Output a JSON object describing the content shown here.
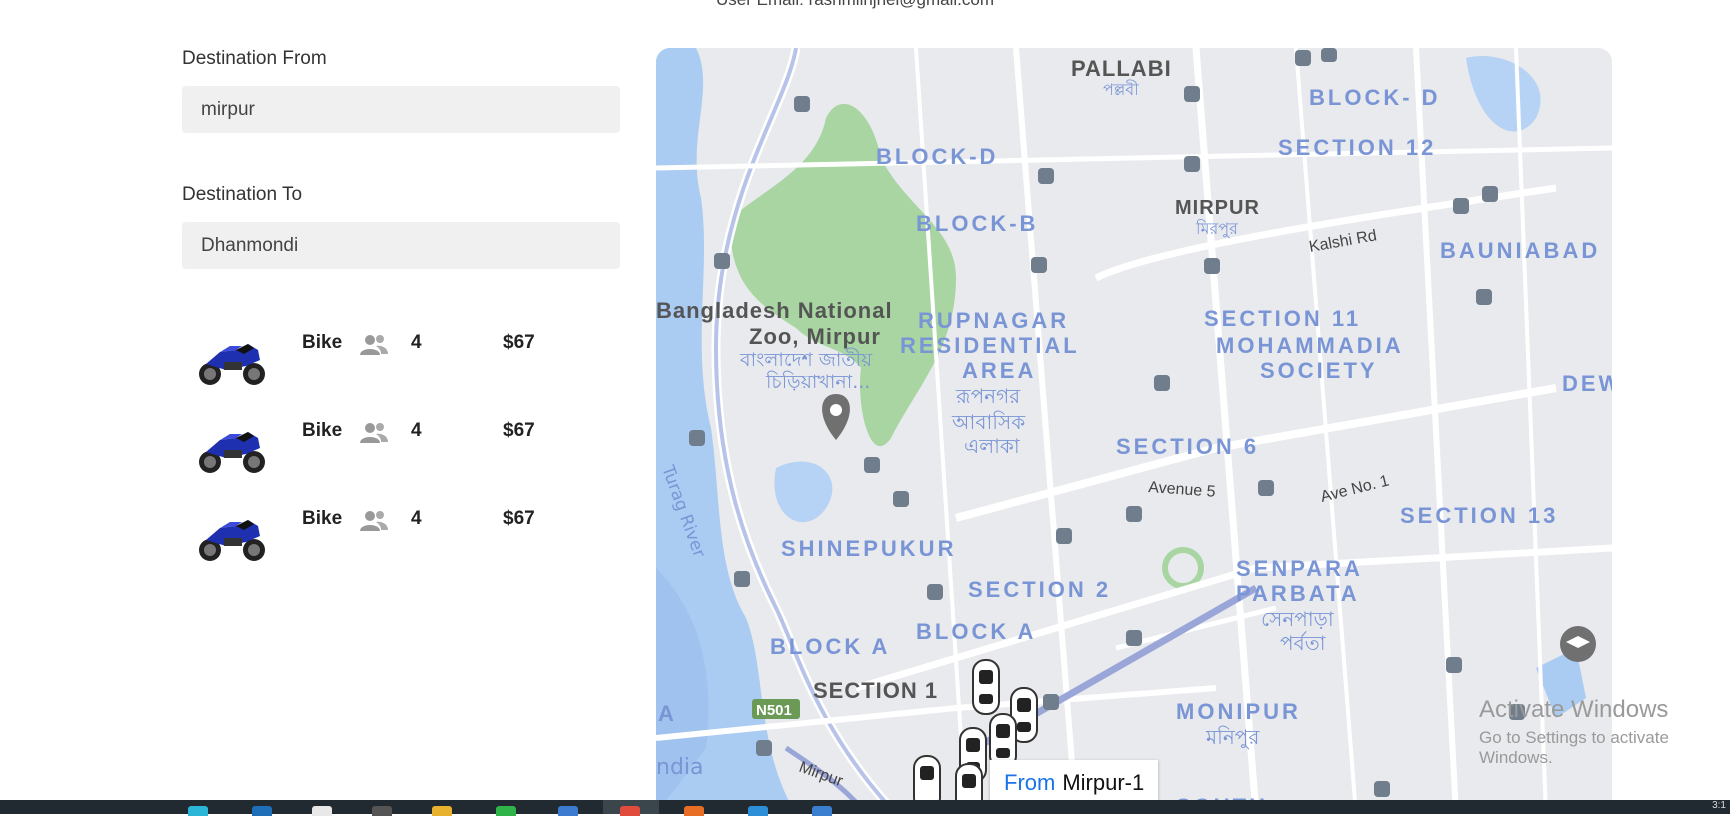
{
  "header": {
    "user_email_text": "User Email: rashmiinjnei@gmail.com"
  },
  "form": {
    "from_label": "Destination From",
    "from_value": "mirpur",
    "to_label": "Destination To",
    "to_value": "Dhanmondi"
  },
  "rides": [
    {
      "name": "Bike",
      "seats": "4",
      "price": "$67",
      "image": "bike-image",
      "icon": "people-icon"
    },
    {
      "name": "Bike",
      "seats": "4",
      "price": "$67",
      "image": "bike-image",
      "icon": "people-icon"
    },
    {
      "name": "Bike",
      "seats": "4",
      "price": "$67",
      "image": "bike-image",
      "icon": "people-icon"
    }
  ],
  "map": {
    "labels": {
      "pallabi": "PALLABI",
      "pallabi_bn": "পল্লবী",
      "block_d_ne": "BLOCK- D",
      "section12": "SECTION 12",
      "block_d": "BLOCK-D",
      "block_b": "BLOCK-B",
      "mirpur": "MIRPUR",
      "mirpur_bn": "মিরপুর",
      "kalshi": "Kalshi Rd",
      "bauniabad": "BAUNIABAD",
      "zoo1": "Bangladesh National",
      "zoo2": "Zoo, Mirpur",
      "zoo_bn1": "বাংলাদেশ জাতীয়",
      "zoo_bn2": "চিড়িয়াখানা...",
      "rupnagar1": "RUPNAGAR",
      "rupnagar2": "RESIDENTIAL",
      "rupnagar3": "AREA",
      "rupnagar_bn1": "রূপনগর",
      "rupnagar_bn2": "আবাসিক",
      "rupnagar_bn3": "এলাকা",
      "section11": "SECTION 11",
      "mohammadia1": "MOHAMMADIA",
      "mohammadia2": "SOCIETY",
      "dew": "DEW",
      "section6": "SECTION 6",
      "avenue5": "Avenue 5",
      "aveno1": "Ave No. 1",
      "section13": "SECTION 13",
      "turag": "Turag River",
      "shinepukur": "SHINEPUKUR",
      "section2": "SECTION 2",
      "senpara1": "SENPARA",
      "senpara2": "PARBATA",
      "senpara_bn1": "সেনপাড়া",
      "senpara_bn2": "পর্বতা",
      "block_a_w": "BLOCK A",
      "block_a_e": "BLOCK A",
      "section1": "SECTION 1",
      "n501": "N501",
      "monipur": "MONIPUR",
      "monipur_bn": "মনিপুর",
      "a_left": "A",
      "india": "ndia",
      "mirpur_rd": "Mirpur",
      "south": "SOUTH"
    },
    "from_tag": {
      "prefix": "From",
      "place": "Mirpur-1"
    }
  },
  "watermark": {
    "title": "Activate Windows",
    "subtitle": "Go to Settings to activate Windows."
  },
  "taskbar": {
    "clock": "3:1"
  }
}
